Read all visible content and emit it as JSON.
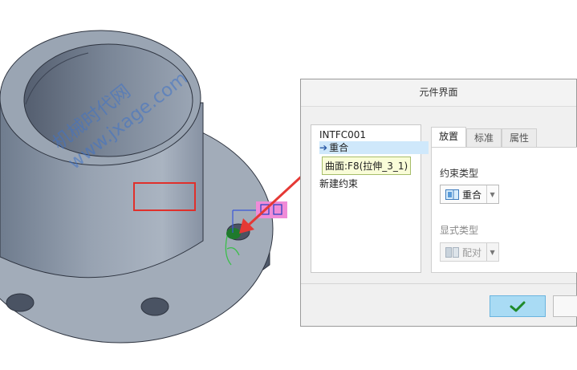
{
  "watermark": {
    "line1": "机械时代网",
    "line2": "www.jxage.com"
  },
  "dialog": {
    "title": "元件界面",
    "tree": {
      "root": "INTFC001",
      "selected": "重合",
      "reference": "曲面:F8(拉伸_3_1)",
      "new_constraint": "新建约束"
    },
    "tabs": [
      "放置",
      "标准",
      "属性"
    ],
    "active_tab": "放置",
    "constraint_type_label": "约束类型",
    "constraint_type_value": "重合",
    "display_type_label": "显式类型",
    "display_type_value": "配对",
    "ok_icon": "checkmark-icon",
    "colors": {
      "accent": "#a9dbf4",
      "highlight": "#e0302b",
      "model": "#7b8798"
    }
  }
}
